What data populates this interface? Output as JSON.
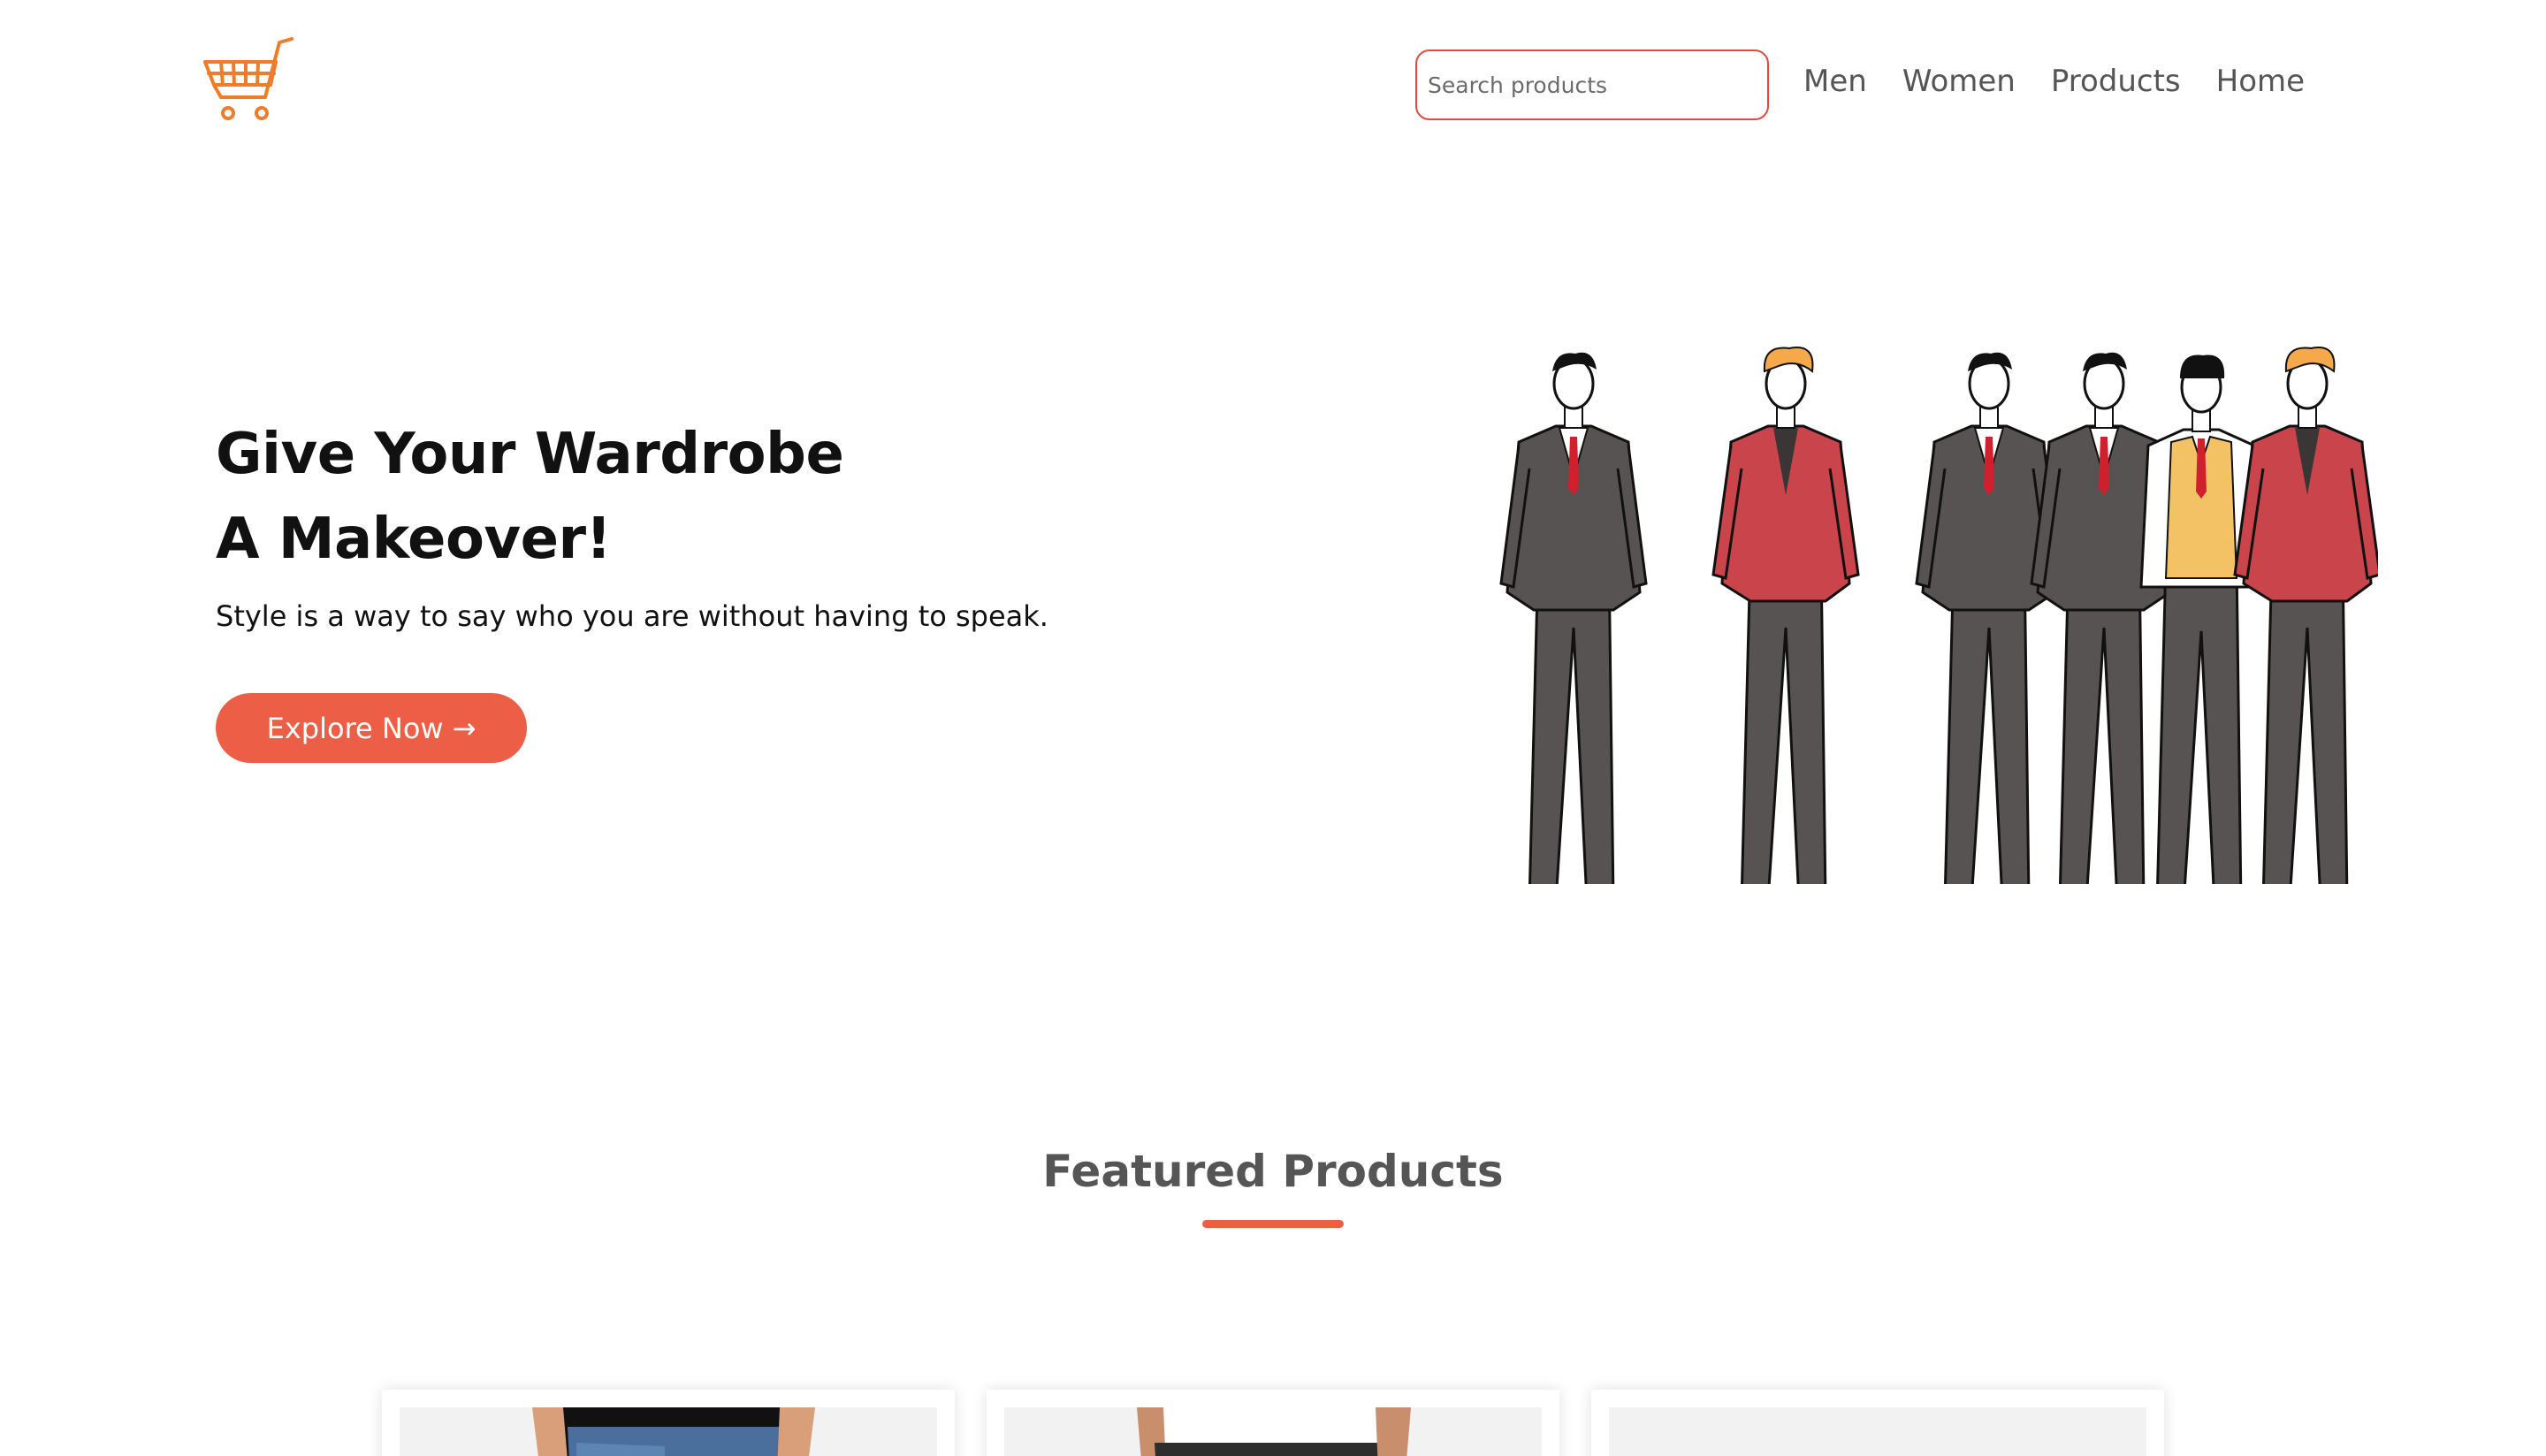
{
  "header": {
    "logo_icon": "shopping-cart-icon",
    "search": {
      "placeholder": "Search products",
      "value": ""
    },
    "nav": [
      "Men",
      "Women",
      "Products",
      "Home"
    ]
  },
  "hero": {
    "title_line1": "Give Your Wardrobe",
    "title_line2": "A Makeover!",
    "subtitle": "Style is a way to say who you are without having to speak.",
    "cta_label": "Explore Now",
    "cta_arrow": "→",
    "illustration_icon": "suited-people-illustration"
  },
  "featured": {
    "title": "Featured Products",
    "products": [
      {
        "image_icon": "jeans-product-image"
      },
      {
        "image_icon": "tshirt-product-image"
      },
      {
        "image_icon": "blank-product-image"
      }
    ]
  },
  "colors": {
    "accent": "#ec5f46",
    "search_border": "#e24a3e",
    "text_dark": "#111111",
    "text_gray": "#555555",
    "logo_orange": "#ee7d2b",
    "suit_gray": "#585353",
    "blazer_red": "#c9444b",
    "vest_yellow": "#f3c265",
    "hair_orange": "#f5a94a"
  }
}
